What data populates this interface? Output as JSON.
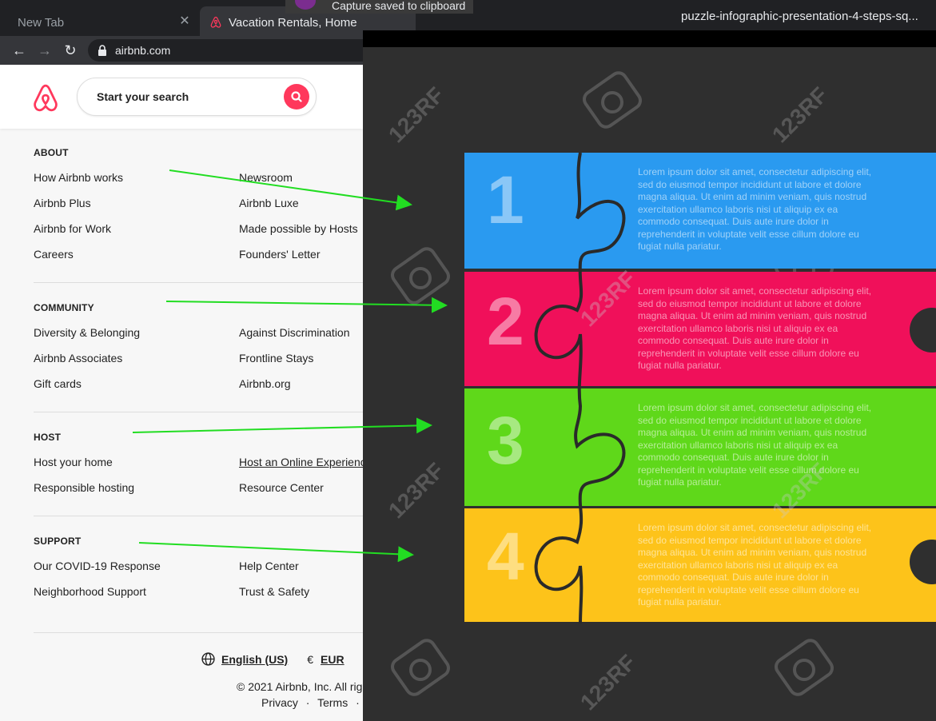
{
  "browser": {
    "tabs": [
      {
        "title": "New Tab"
      },
      {
        "title": "Vacation Rentals, Homes"
      }
    ],
    "url": "airbnb.com",
    "viewer_title": "puzzle-infographic-presentation-4-steps-sq..."
  },
  "toast": {
    "text": "Capture saved to clipboard"
  },
  "header": {
    "search_placeholder": "Start your search"
  },
  "footer": {
    "sections": [
      {
        "title": "ABOUT",
        "links": [
          "How Airbnb works",
          "Newsroom",
          "Airbnb Plus",
          "Airbnb Luxe",
          "Airbnb for Work",
          "Made possible by Hosts",
          "Careers",
          "Founders' Letter"
        ]
      },
      {
        "title": "COMMUNITY",
        "links": [
          "Diversity & Belonging",
          "Against Discrimination",
          "Airbnb Associates",
          "Frontline Stays",
          "Gift cards",
          "Airbnb.org"
        ]
      },
      {
        "title": "HOST",
        "links": [
          "Host your home",
          "Host an Online Experience",
          "Responsible hosting",
          "Resource Center"
        ]
      },
      {
        "title": "SUPPORT",
        "links": [
          "Our COVID-19 Response",
          "Help Center",
          "Neighborhood Support",
          "Trust & Safety"
        ]
      }
    ],
    "language": "English (US)",
    "currency_symbol": "€",
    "currency": "EUR",
    "copyright": "© 2021 Airbnb, Inc. All rig",
    "legal_privacy": "Privacy",
    "legal_sep": "·",
    "legal_terms": "Terms",
    "legal_more": "· S"
  },
  "infographic": {
    "steps": [
      {
        "number": "1",
        "color": "#2a9af0"
      },
      {
        "number": "2",
        "color": "#f0105a"
      },
      {
        "number": "3",
        "color": "#5fd81a"
      },
      {
        "number": "4",
        "color": "#fdc31a"
      }
    ],
    "body_text": "Lorem ipsum dolor sit amet, consectetur adipiscing elit, sed do eiusmod tempor incididunt ut labore et dolore magna aliqua. Ut enim ad minim veniam, quis nostrud exercitation ullamco laboris nisi ut aliquip ex ea commodo consequat. Duis aute irure dolor in reprehenderit in voluptate velit esse cillum dolore eu fugiat nulla pariatur.",
    "watermark": "123RF"
  },
  "colors": {
    "airbnb_brand": "#ff385c",
    "arrow": "#22dd22",
    "viewer_bg": "#2f2f2f"
  }
}
